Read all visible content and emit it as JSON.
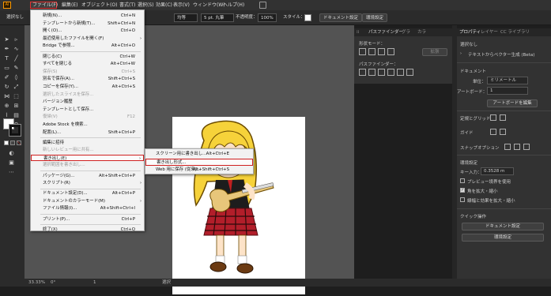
{
  "menubar": {
    "logo": "Ai",
    "items": [
      "ファイル(F)",
      "編集(E)",
      "オブジェクト(O)",
      "書式(T)",
      "選択(S)",
      "効果(C)",
      "表示(V)",
      "ウィンドウ(W)",
      "ヘルプ(H)"
    ]
  },
  "controlbar": {
    "selection": "選択なし",
    "stroke_style": "均等",
    "brush": "5 pt. 丸筆",
    "opacity_label": "不透明度：",
    "opacity_value": "100%",
    "style_label": "スタイル：",
    "doc_setup": "ドキュメント設定",
    "preferences": "環境設定"
  },
  "file_menu": {
    "items": [
      {
        "label": "新規(N)...",
        "shortcut": "Ctrl+N",
        "disabled": false
      },
      {
        "label": "テンプレートから新規(T)...",
        "shortcut": "Shift+Ctrl+N",
        "disabled": false
      },
      {
        "label": "開く(O)...",
        "shortcut": "Ctrl+O",
        "disabled": false
      },
      {
        "label": "最近使用したファイルを開く(F)",
        "shortcut": "",
        "disabled": false,
        "submenu": true
      },
      {
        "label": "Bridge で参照...",
        "shortcut": "Alt+Ctrl+O",
        "disabled": false,
        "sep_after": true
      },
      {
        "label": "閉じる(C)",
        "shortcut": "Ctrl+W",
        "disabled": false
      },
      {
        "label": "すべてを閉じる",
        "shortcut": "Alt+Ctrl+W",
        "disabled": false
      },
      {
        "label": "保存(S)",
        "shortcut": "Ctrl+S",
        "disabled": true
      },
      {
        "label": "別名で保存(A)...",
        "shortcut": "Shift+Ctrl+S",
        "disabled": false
      },
      {
        "label": "コピーを保存(Y)...",
        "shortcut": "Alt+Ctrl+S",
        "disabled": false
      },
      {
        "label": "選択したスライスを保存...",
        "shortcut": "",
        "disabled": true
      },
      {
        "label": "バージョン履歴",
        "shortcut": "",
        "disabled": false
      },
      {
        "label": "テンプレートとして保存...",
        "shortcut": "",
        "disabled": false
      },
      {
        "label": "復帰(V)",
        "shortcut": "F12",
        "disabled": true
      },
      {
        "label": "Adobe Stock を検索...",
        "shortcut": "",
        "disabled": false
      },
      {
        "label": "配置(L)...",
        "shortcut": "Shift+Ctrl+P",
        "disabled": false,
        "sep_after": true
      },
      {
        "label": "編集に招待",
        "shortcut": "",
        "disabled": false
      },
      {
        "label": "新しいレビュー用に共有...",
        "shortcut": "",
        "disabled": true
      },
      {
        "label": "書き出し(E)",
        "shortcut": "",
        "disabled": false,
        "submenu": true,
        "highlight": true
      },
      {
        "label": "選択範囲を書き出し...",
        "shortcut": "",
        "disabled": true,
        "sep_after": true
      },
      {
        "label": "パッケージ(G)...",
        "shortcut": "Alt+Shift+Ctrl+P",
        "disabled": false
      },
      {
        "label": "スクリプト(R)",
        "shortcut": "",
        "disabled": false,
        "submenu": true,
        "sep_after": true
      },
      {
        "label": "ドキュメント設定(D)...",
        "shortcut": "Alt+Ctrl+P",
        "disabled": false
      },
      {
        "label": "ドキュメントのカラーモード(M)",
        "shortcut": "",
        "disabled": false,
        "submenu": true
      },
      {
        "label": "ファイル情報(I)...",
        "shortcut": "Alt+Shift+Ctrl+I",
        "disabled": false,
        "sep_after": true
      },
      {
        "label": "プリント(P)...",
        "shortcut": "Ctrl+P",
        "disabled": false,
        "sep_after": true
      },
      {
        "label": "終了(X)",
        "shortcut": "Ctrl+Q",
        "disabled": false
      }
    ]
  },
  "export_submenu": {
    "items": [
      {
        "label": "スクリーン用に書き出し...",
        "shortcut": "Alt+Ctrl+E"
      },
      {
        "label": "書き出し形式...",
        "shortcut": "",
        "highlight": true
      },
      {
        "label": "Web 用に保存 (従来)...",
        "shortcut": "Alt+Shift+Ctrl+S"
      }
    ]
  },
  "mid_panel": {
    "tabs": [
      "パスファインダー",
      "グラ",
      "カラ"
    ],
    "shape_mode": "形状モード：",
    "expand": "拡張",
    "pathfinder": "パスファインダー："
  },
  "properties": {
    "tabs": [
      "プロパティ",
      "レイヤー",
      "CC ライブラリ"
    ],
    "no_selection": "選択なし",
    "vectorize": "テキストからベクター生成 (Beta)",
    "document_heading": "ドキュメント",
    "unit_label": "単位：",
    "unit_value": "ミリメートル",
    "artboard_label": "アートボード：",
    "artboard_value": "1",
    "edit_artboard": "アートボードを編集",
    "rulers_grids": "定規とグリッド",
    "guides": "ガイド",
    "snap_options": "スナップオプション",
    "preferences_heading": "環境設定",
    "key_increment_label": "キー入力：",
    "key_increment_value": "0.3528 m",
    "preview_bounds": "プレビュー境界を使用",
    "scale_corners": "角を拡大・縮小",
    "scale_strokes": "線幅と効果を拡大・縮小",
    "quick_actions": "クイック操作",
    "quick_doc_setup": "ドキュメント設定",
    "quick_preferences": "環境設定"
  },
  "checks": {
    "preview_bounds": false,
    "scale_corners": true,
    "scale_strokes": false
  },
  "status": {
    "zoom": "33.33%",
    "rotation": "0°",
    "artboard": "1",
    "tool": "選択"
  },
  "colors": {
    "accent_red": "#d02020",
    "panel_bg": "#323232",
    "canvas_bg": "#535353"
  }
}
